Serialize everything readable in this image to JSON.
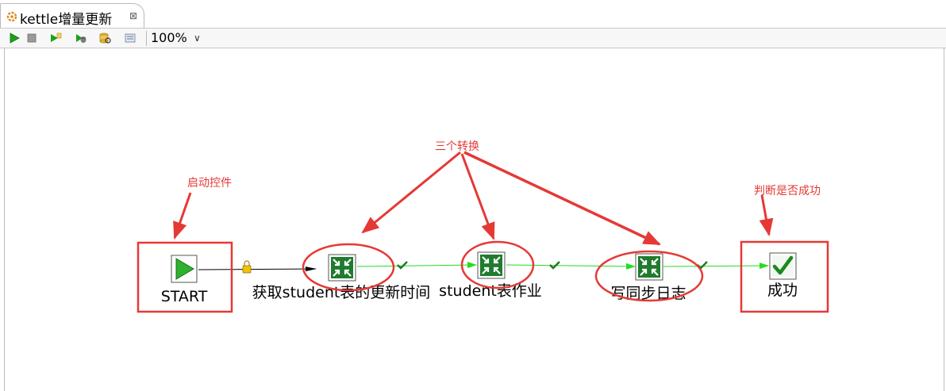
{
  "tab": {
    "title": "kettle增量更新",
    "close": "⊠"
  },
  "toolbar": {
    "buttons": [
      "run-icon",
      "stop-icon",
      "preview-icon",
      "debug-icon",
      "verify-icon",
      "sql-icon"
    ],
    "zoom": "100%",
    "zoom_caret": "∨"
  },
  "diagram": {
    "nodes": [
      {
        "id": "start",
        "label": "START",
        "type": "start-entry"
      },
      {
        "id": "trans1",
        "label": "获取student表的更新时间",
        "type": "transformation-entry"
      },
      {
        "id": "trans2",
        "label": "student表作业",
        "type": "transformation-entry"
      },
      {
        "id": "trans3",
        "label": "写同步日志",
        "type": "transformation-entry"
      },
      {
        "id": "success",
        "label": "成功",
        "type": "success-entry"
      }
    ],
    "annotations": {
      "start": "启动控件",
      "transforms": "三个转换",
      "success": "判断是否成功"
    },
    "colors": {
      "annotation": "#e53935",
      "hop_success": "#22dd22",
      "hop_unconditional": "#000000",
      "node_border": "#555555"
    }
  }
}
